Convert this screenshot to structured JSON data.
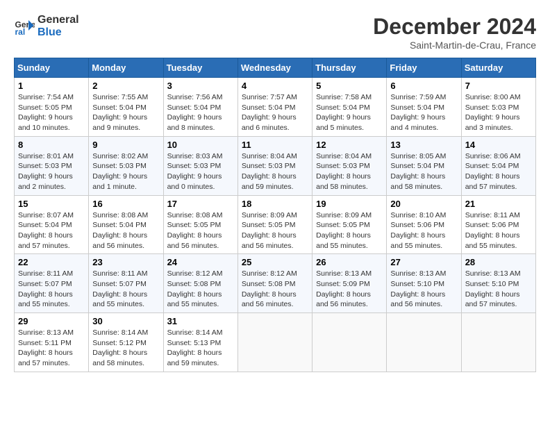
{
  "logo": {
    "line1": "General",
    "line2": "Blue"
  },
  "title": "December 2024",
  "subtitle": "Saint-Martin-de-Crau, France",
  "headers": [
    "Sunday",
    "Monday",
    "Tuesday",
    "Wednesday",
    "Thursday",
    "Friday",
    "Saturday"
  ],
  "weeks": [
    [
      {
        "day": "1",
        "info": "Sunrise: 7:54 AM\nSunset: 5:05 PM\nDaylight: 9 hours\nand 10 minutes."
      },
      {
        "day": "2",
        "info": "Sunrise: 7:55 AM\nSunset: 5:04 PM\nDaylight: 9 hours\nand 9 minutes."
      },
      {
        "day": "3",
        "info": "Sunrise: 7:56 AM\nSunset: 5:04 PM\nDaylight: 9 hours\nand 8 minutes."
      },
      {
        "day": "4",
        "info": "Sunrise: 7:57 AM\nSunset: 5:04 PM\nDaylight: 9 hours\nand 6 minutes."
      },
      {
        "day": "5",
        "info": "Sunrise: 7:58 AM\nSunset: 5:04 PM\nDaylight: 9 hours\nand 5 minutes."
      },
      {
        "day": "6",
        "info": "Sunrise: 7:59 AM\nSunset: 5:04 PM\nDaylight: 9 hours\nand 4 minutes."
      },
      {
        "day": "7",
        "info": "Sunrise: 8:00 AM\nSunset: 5:03 PM\nDaylight: 9 hours\nand 3 minutes."
      }
    ],
    [
      {
        "day": "8",
        "info": "Sunrise: 8:01 AM\nSunset: 5:03 PM\nDaylight: 9 hours\nand 2 minutes."
      },
      {
        "day": "9",
        "info": "Sunrise: 8:02 AM\nSunset: 5:03 PM\nDaylight: 9 hours\nand 1 minute."
      },
      {
        "day": "10",
        "info": "Sunrise: 8:03 AM\nSunset: 5:03 PM\nDaylight: 9 hours\nand 0 minutes."
      },
      {
        "day": "11",
        "info": "Sunrise: 8:04 AM\nSunset: 5:03 PM\nDaylight: 8 hours\nand 59 minutes."
      },
      {
        "day": "12",
        "info": "Sunrise: 8:04 AM\nSunset: 5:03 PM\nDaylight: 8 hours\nand 58 minutes."
      },
      {
        "day": "13",
        "info": "Sunrise: 8:05 AM\nSunset: 5:04 PM\nDaylight: 8 hours\nand 58 minutes."
      },
      {
        "day": "14",
        "info": "Sunrise: 8:06 AM\nSunset: 5:04 PM\nDaylight: 8 hours\nand 57 minutes."
      }
    ],
    [
      {
        "day": "15",
        "info": "Sunrise: 8:07 AM\nSunset: 5:04 PM\nDaylight: 8 hours\nand 57 minutes."
      },
      {
        "day": "16",
        "info": "Sunrise: 8:08 AM\nSunset: 5:04 PM\nDaylight: 8 hours\nand 56 minutes."
      },
      {
        "day": "17",
        "info": "Sunrise: 8:08 AM\nSunset: 5:05 PM\nDaylight: 8 hours\nand 56 minutes."
      },
      {
        "day": "18",
        "info": "Sunrise: 8:09 AM\nSunset: 5:05 PM\nDaylight: 8 hours\nand 56 minutes."
      },
      {
        "day": "19",
        "info": "Sunrise: 8:09 AM\nSunset: 5:05 PM\nDaylight: 8 hours\nand 55 minutes."
      },
      {
        "day": "20",
        "info": "Sunrise: 8:10 AM\nSunset: 5:06 PM\nDaylight: 8 hours\nand 55 minutes."
      },
      {
        "day": "21",
        "info": "Sunrise: 8:11 AM\nSunset: 5:06 PM\nDaylight: 8 hours\nand 55 minutes."
      }
    ],
    [
      {
        "day": "22",
        "info": "Sunrise: 8:11 AM\nSunset: 5:07 PM\nDaylight: 8 hours\nand 55 minutes."
      },
      {
        "day": "23",
        "info": "Sunrise: 8:11 AM\nSunset: 5:07 PM\nDaylight: 8 hours\nand 55 minutes."
      },
      {
        "day": "24",
        "info": "Sunrise: 8:12 AM\nSunset: 5:08 PM\nDaylight: 8 hours\nand 55 minutes."
      },
      {
        "day": "25",
        "info": "Sunrise: 8:12 AM\nSunset: 5:08 PM\nDaylight: 8 hours\nand 56 minutes."
      },
      {
        "day": "26",
        "info": "Sunrise: 8:13 AM\nSunset: 5:09 PM\nDaylight: 8 hours\nand 56 minutes."
      },
      {
        "day": "27",
        "info": "Sunrise: 8:13 AM\nSunset: 5:10 PM\nDaylight: 8 hours\nand 56 minutes."
      },
      {
        "day": "28",
        "info": "Sunrise: 8:13 AM\nSunset: 5:10 PM\nDaylight: 8 hours\nand 57 minutes."
      }
    ],
    [
      {
        "day": "29",
        "info": "Sunrise: 8:13 AM\nSunset: 5:11 PM\nDaylight: 8 hours\nand 57 minutes."
      },
      {
        "day": "30",
        "info": "Sunrise: 8:14 AM\nSunset: 5:12 PM\nDaylight: 8 hours\nand 58 minutes."
      },
      {
        "day": "31",
        "info": "Sunrise: 8:14 AM\nSunset: 5:13 PM\nDaylight: 8 hours\nand 59 minutes."
      },
      {
        "day": "",
        "info": ""
      },
      {
        "day": "",
        "info": ""
      },
      {
        "day": "",
        "info": ""
      },
      {
        "day": "",
        "info": ""
      }
    ]
  ]
}
